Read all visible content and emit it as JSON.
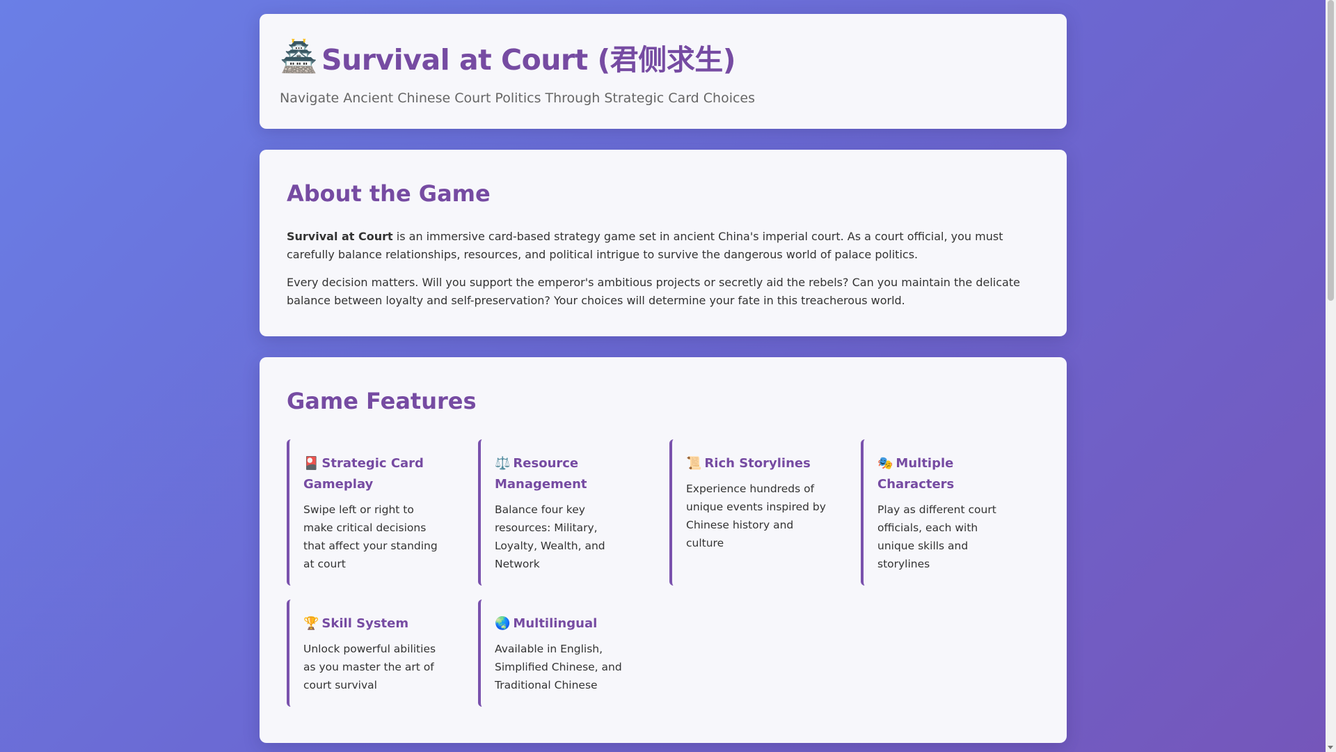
{
  "header": {
    "icon": "pagoda-icon",
    "emoji": "🏯",
    "title": "Survival at Court (君侧求生)",
    "subtitle": "Navigate Ancient Chinese Court Politics Through Strategic Card Choices"
  },
  "about": {
    "heading": "About the Game",
    "p1_bold": "Survival at Court",
    "p1_rest": " is an immersive card-based strategy game set in ancient China's imperial court. As a court official, you must carefully balance relationships, resources, and political intrigue to survive the dangerous world of palace politics.",
    "p2": "Every decision matters. Will you support the emperor's ambitious projects or secretly aid the rebels? Can you maintain the delicate balance between loyalty and self-preservation? Your choices will determine your fate in this treacherous world."
  },
  "features": {
    "heading": "Game Features",
    "items": [
      {
        "icon": "🎴",
        "title": "Strategic Card Gameplay",
        "desc": "Swipe left or right to make critical decisions that affect your standing at court"
      },
      {
        "icon": "⚖️",
        "title": "Resource Management",
        "desc": "Balance four key resources: Military, Loyalty, Wealth, and Network"
      },
      {
        "icon": "📜",
        "title": "Rich Storylines",
        "desc": "Experience hundreds of unique events inspired by Chinese history and culture"
      },
      {
        "icon": "🎭",
        "title": "Multiple Characters",
        "desc": "Play as different court officials, each with unique skills and storylines"
      },
      {
        "icon": "🏆",
        "title": "Skill System",
        "desc": "Unlock powerful abilities as you master the art of court survival"
      },
      {
        "icon": "🌏",
        "title": "Multilingual",
        "desc": "Available in English, Simplified Chinese, and Traditional Chinese"
      }
    ]
  },
  "colors": {
    "accent": "#764ba2",
    "gradient_start": "#667eea",
    "gradient_end": "#764ba2"
  }
}
